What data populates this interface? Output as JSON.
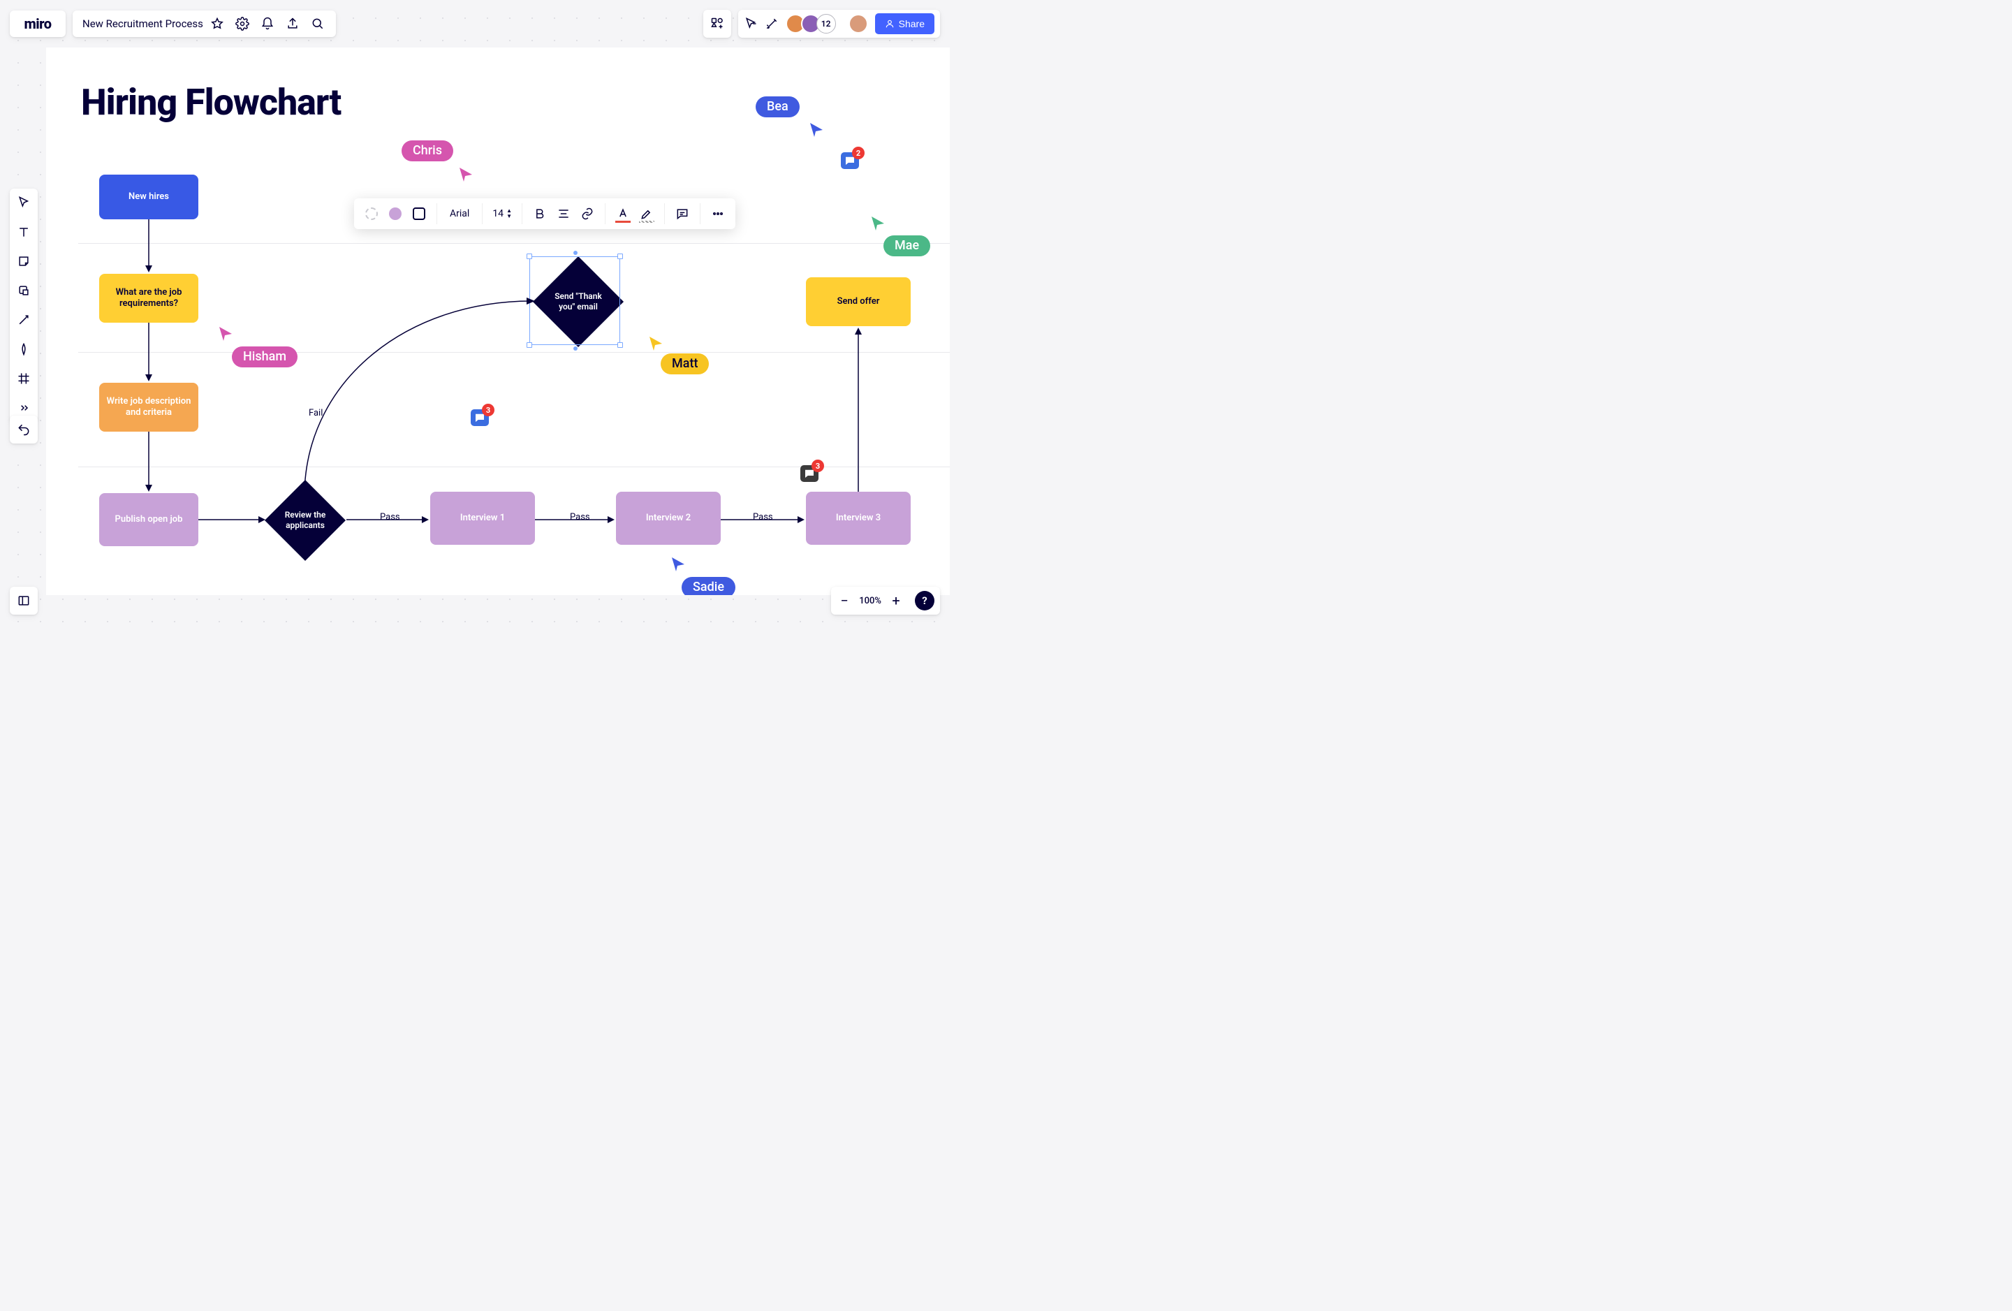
{
  "app": {
    "logo": "miro"
  },
  "board": {
    "title": "New Recruitment Process"
  },
  "collaborators": {
    "overflow_count": "12"
  },
  "share": {
    "label": "Share"
  },
  "zoom": {
    "level": "100%"
  },
  "frame": {
    "title": "Hiring Flowchart"
  },
  "nodes": {
    "new_hires": "New hires",
    "requirements": "What are the job requirements?",
    "write_jd": "Write job description and criteria",
    "publish": "Publish open job",
    "review": "Review the applicants",
    "thank_you": "Send \"Thank you\" email",
    "interview1": "Interview 1",
    "interview2": "Interview 2",
    "interview3": "Interview 3",
    "send_offer": "Send offer"
  },
  "edges": {
    "fail": "Fail",
    "pass1": "Pass",
    "pass2": "Pass",
    "pass3": "Pass"
  },
  "cursors": {
    "chris": "Chris",
    "hisham": "Hisham",
    "matt": "Matt",
    "sadie": "Sadie",
    "bea": "Bea",
    "mae": "Mae"
  },
  "ctx_toolbar": {
    "font": "Arial",
    "size": "14"
  },
  "comments": {
    "c1": "3",
    "c2": "2",
    "c3": "3"
  }
}
